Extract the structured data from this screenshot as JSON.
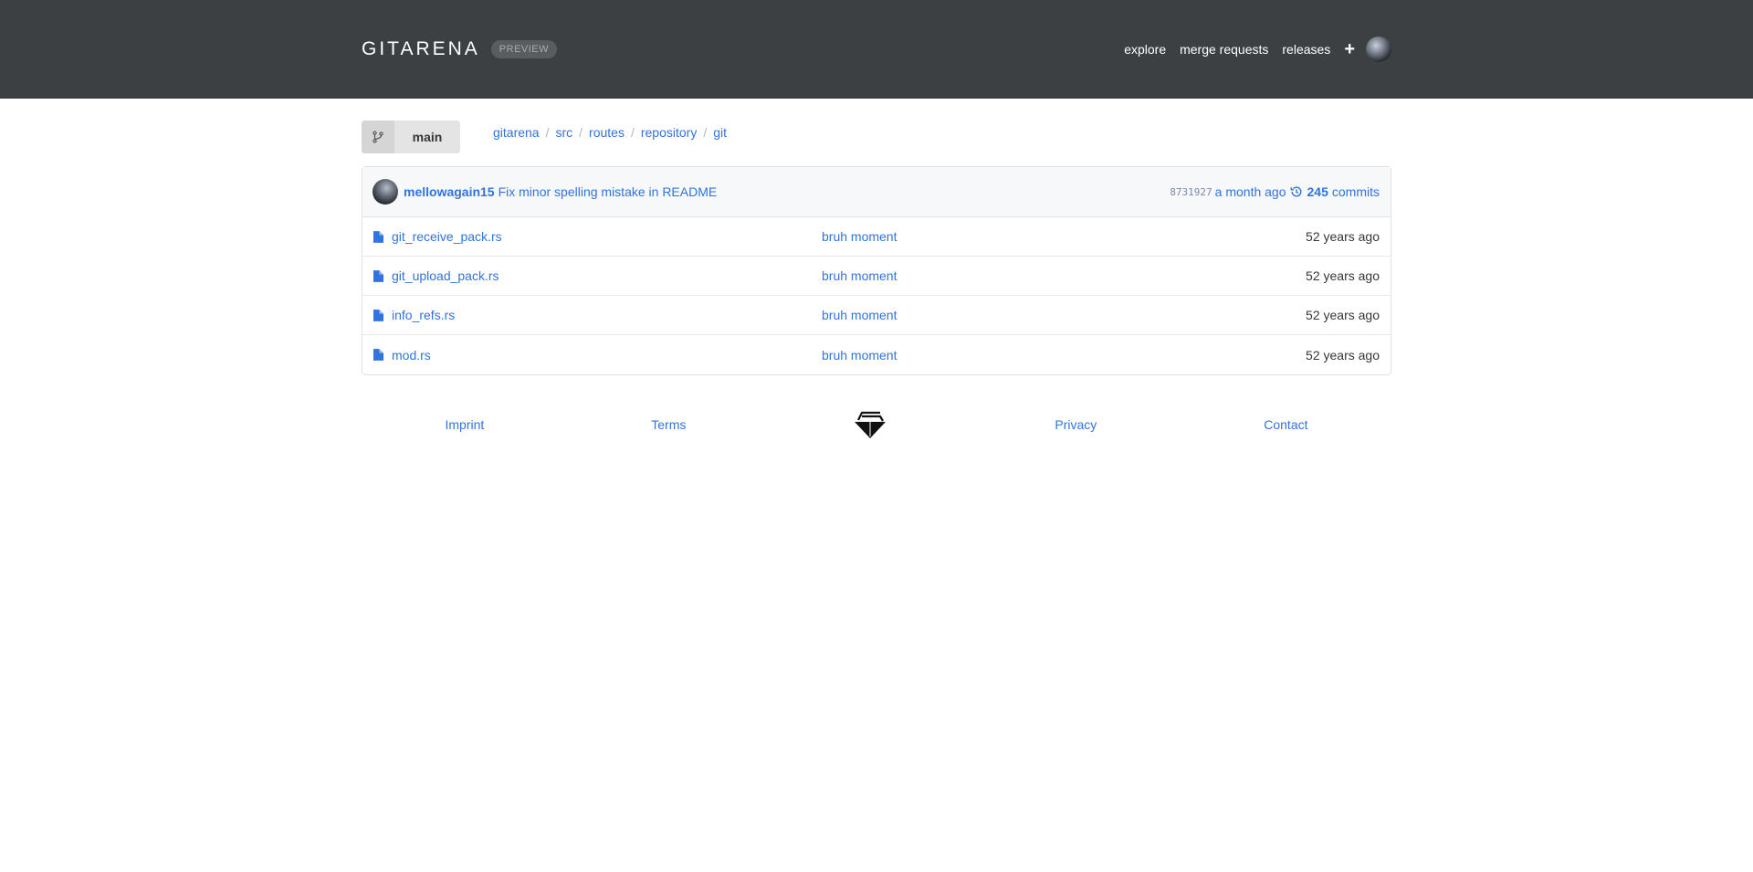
{
  "navbar": {
    "brand": "GITARENA",
    "badge": "PREVIEW",
    "links": [
      "explore",
      "merge requests",
      "releases"
    ],
    "plus": "+"
  },
  "toolbar": {
    "branch": "main",
    "breadcrumb": [
      "gitarena",
      "src",
      "routes",
      "repository",
      "git"
    ]
  },
  "commit": {
    "author": "mellowagain15",
    "message": "Fix minor spelling mistake in README",
    "hash": "8731927",
    "time": "a month ago",
    "count": "245",
    "count_label": "commits"
  },
  "files": [
    {
      "name": "git_receive_pack.rs",
      "message": "bruh moment",
      "time": "52 years ago"
    },
    {
      "name": "git_upload_pack.rs",
      "message": "bruh moment",
      "time": "52 years ago"
    },
    {
      "name": "info_refs.rs",
      "message": "bruh moment",
      "time": "52 years ago"
    },
    {
      "name": "mod.rs",
      "message": "bruh moment",
      "time": "52 years ago"
    }
  ],
  "footer": {
    "links": [
      "Imprint",
      "Terms",
      "Privacy",
      "Contact"
    ]
  },
  "colors": {
    "navbar_bg": "#3d4043",
    "link": "#3273dc",
    "header_bg": "#f7f8fa"
  },
  "icons": [
    "branch-icon",
    "history-icon",
    "file-icon",
    "plus-icon",
    "logo-icon"
  ]
}
